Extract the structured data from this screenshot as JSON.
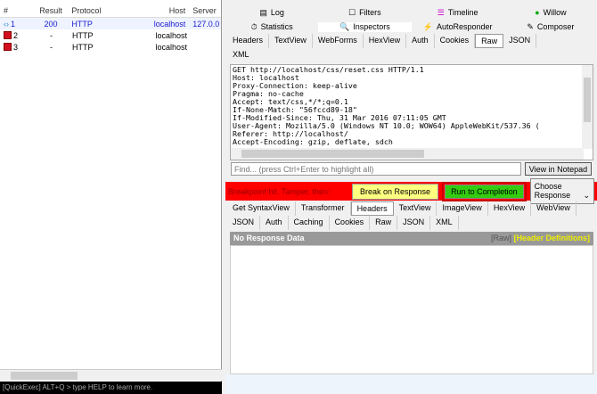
{
  "sessions": {
    "headers": [
      "#",
      "Result",
      "Protocol",
      "Host",
      "Server"
    ],
    "rows": [
      {
        "id": "1",
        "result": "200",
        "protocol": "HTTP",
        "host": "localhost",
        "server": "127.0.0"
      },
      {
        "id": "2",
        "result": "-",
        "protocol": "HTTP",
        "host": "localhost",
        "server": ""
      },
      {
        "id": "3",
        "result": "-",
        "protocol": "HTTP",
        "host": "localhost",
        "server": ""
      }
    ]
  },
  "quickexec": "[QuickExec] ALT+Q > type HELP to learn more.",
  "main_tabs": {
    "row1": [
      "Log",
      "Filters",
      "Timeline",
      "Willow"
    ],
    "row2": [
      "Statistics",
      "Inspectors",
      "AutoResponder",
      "Composer"
    ]
  },
  "request_tabs": [
    "Headers",
    "TextView",
    "WebForms",
    "HexView",
    "Auth",
    "Cookies",
    "Raw",
    "JSON",
    "XML"
  ],
  "request_raw": "GET http://localhost/css/reset.css HTTP/1.1\nHost: localhost\nProxy-Connection: keep-alive\nPragma: no-cache\nAccept: text/css,*/*;q=0.1\nIf-None-Match: \"56fccd89-18\"\nIf-Modified-Since: Thu, 31 Mar 2016 07:11:05 GMT\nUser-Agent: Mozilla/5.0 (Windows NT 10.0; WOW64) AppleWebKit/537.36 (\nReferer: http://localhost/\nAccept-Encoding: gzip, deflate, sdch",
  "find_placeholder": "Find... (press Ctrl+Enter to highlight all)",
  "view_notepad": "View in Notepad",
  "breakpoint": {
    "text": "Breakpoint hit. Tamper, then:",
    "break_on_response": "Break on Response",
    "run_to_completion": "Run to Completion",
    "choose_response": "Choose Response"
  },
  "response_tabs": [
    "Get SyntaxView",
    "Transformer",
    "Headers",
    "TextView",
    "ImageView",
    "HexView",
    "WebView",
    "JSON",
    "Auth",
    "Caching",
    "Cookies",
    "Raw",
    "JSON",
    "XML"
  ],
  "response": {
    "title": "No Response Data",
    "raw": "[Raw]",
    "header_defs": "[Header Definitions]"
  }
}
